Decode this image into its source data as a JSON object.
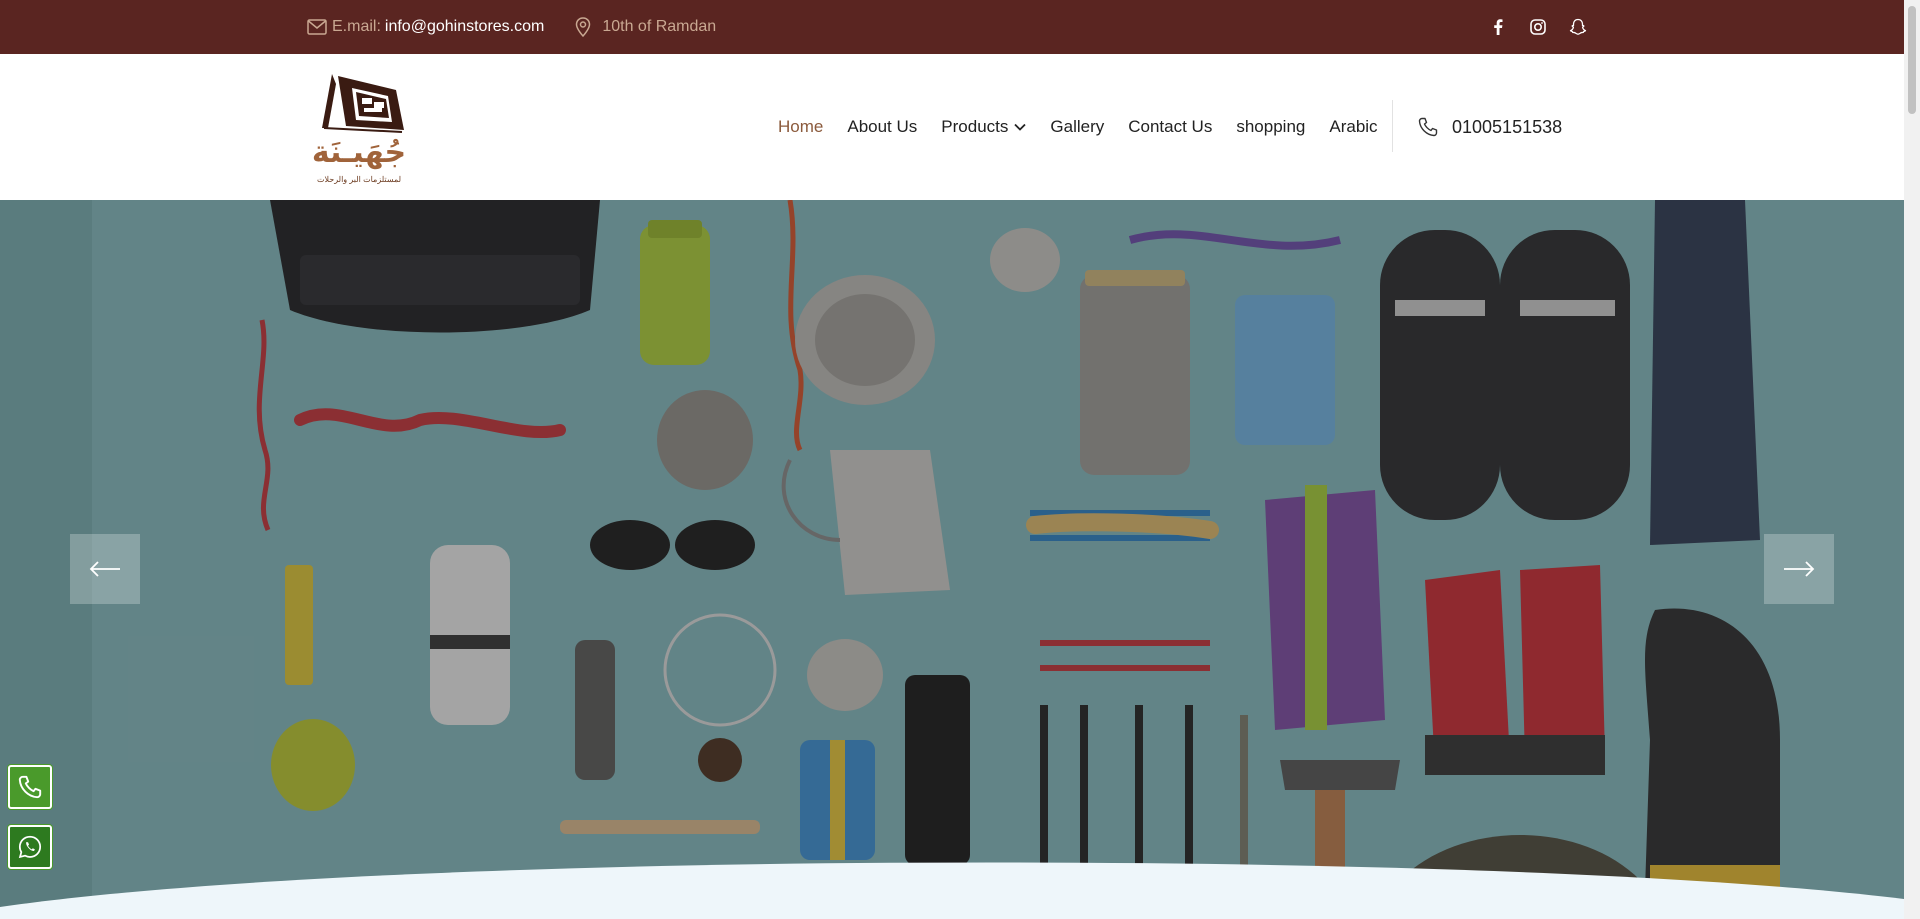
{
  "topbar": {
    "email_label": "E.mail:",
    "email_value": "info@gohinstores.com",
    "address": "10th of Ramdan",
    "icons": [
      "mail-icon",
      "location-pin-icon",
      "facebook-icon",
      "instagram-icon",
      "snapchat-icon"
    ]
  },
  "logo": {
    "wordmark": "جُهَيـنَة",
    "tagline": "لمستلزمات البر والرحلات"
  },
  "nav": {
    "items": [
      {
        "label": "Home",
        "active": true
      },
      {
        "label": "About Us"
      },
      {
        "label": "Products",
        "has_dropdown": true
      },
      {
        "label": "Gallery"
      },
      {
        "label": "Contact Us"
      },
      {
        "label": "shopping"
      },
      {
        "label": "Arabic"
      }
    ]
  },
  "phone": {
    "number": "01005151538"
  },
  "hero": {
    "prev_icon": "arrow-left-icon",
    "next_icon": "arrow-right-icon"
  },
  "colors": {
    "topbar_bg": "#5a2521",
    "accent": "#8b5a3c",
    "hero_bg": "#7fb3b7",
    "float_green": "#4a9a2b"
  }
}
